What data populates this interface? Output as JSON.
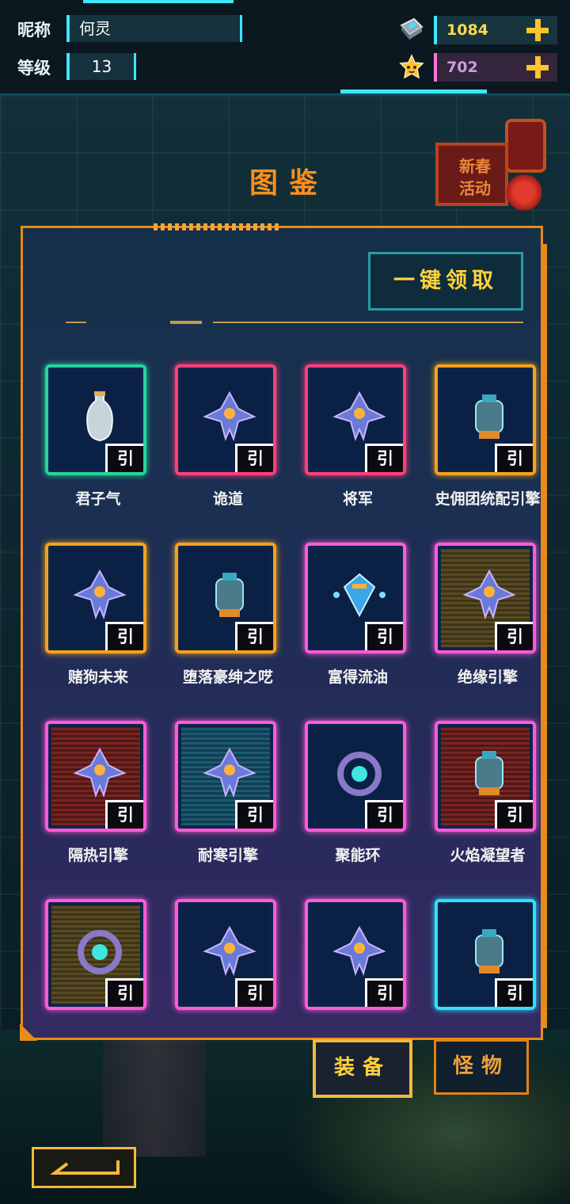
{
  "hud": {
    "nickname_label": "昵称",
    "nickname": "何灵",
    "level_label": "等级",
    "level": "13",
    "gems": "1084",
    "stars": "702"
  },
  "event": {
    "line1": "新春",
    "line2": "活动"
  },
  "title": "图鉴",
  "claim_all": "一键领取",
  "tag_label": "引",
  "items": [
    {
      "name": "君子气",
      "frame": "#27d39a",
      "bg": "plain",
      "art": "vase-icon"
    },
    {
      "name": "诡道",
      "frame": "#ff3e7a",
      "bg": "plain",
      "art": "ship-icon"
    },
    {
      "name": "将军",
      "frame": "#ff3e7a",
      "bg": "plain",
      "art": "ship-icon"
    },
    {
      "name": "史佣团统配引擎",
      "frame": "#f4a21c",
      "bg": "plain",
      "art": "engine-icon"
    },
    {
      "name": "赌狗未来",
      "frame": "#f4a21c",
      "bg": "plain",
      "art": "ship-icon"
    },
    {
      "name": "堕落豪绅之呓",
      "frame": "#f4a21c",
      "bg": "plain",
      "art": "engine-icon"
    },
    {
      "name": "富得流油",
      "frame": "#ff5ad8",
      "bg": "plain",
      "art": "gem-icon"
    },
    {
      "name": "绝缘引擎",
      "frame": "#ff5ad8",
      "bg": "striped-gold",
      "art": "ship-icon"
    },
    {
      "name": "隔热引擎",
      "frame": "#ff5ad8",
      "bg": "striped-red",
      "art": "ship-icon"
    },
    {
      "name": "耐寒引擎",
      "frame": "#ff5ad8",
      "bg": "striped-blue",
      "art": "ship-icon"
    },
    {
      "name": "聚能环",
      "frame": "#ff5ad8",
      "bg": "plain",
      "art": "ring-icon"
    },
    {
      "name": "火焰凝望者",
      "frame": "#ff5ad8",
      "bg": "striped-red",
      "art": "engine-icon"
    },
    {
      "name": "",
      "frame": "#ff5ad8",
      "bg": "striped-gold",
      "art": "ring-icon"
    },
    {
      "name": "",
      "frame": "#ff5ad8",
      "bg": "plain",
      "art": "ship-icon"
    },
    {
      "name": "",
      "frame": "#ff5ad8",
      "bg": "plain",
      "art": "ship-icon"
    },
    {
      "name": "",
      "frame": "#2ee0ff",
      "bg": "plain",
      "art": "engine-icon"
    }
  ],
  "tabs": {
    "equipment": "装备",
    "monsters": "怪物"
  }
}
